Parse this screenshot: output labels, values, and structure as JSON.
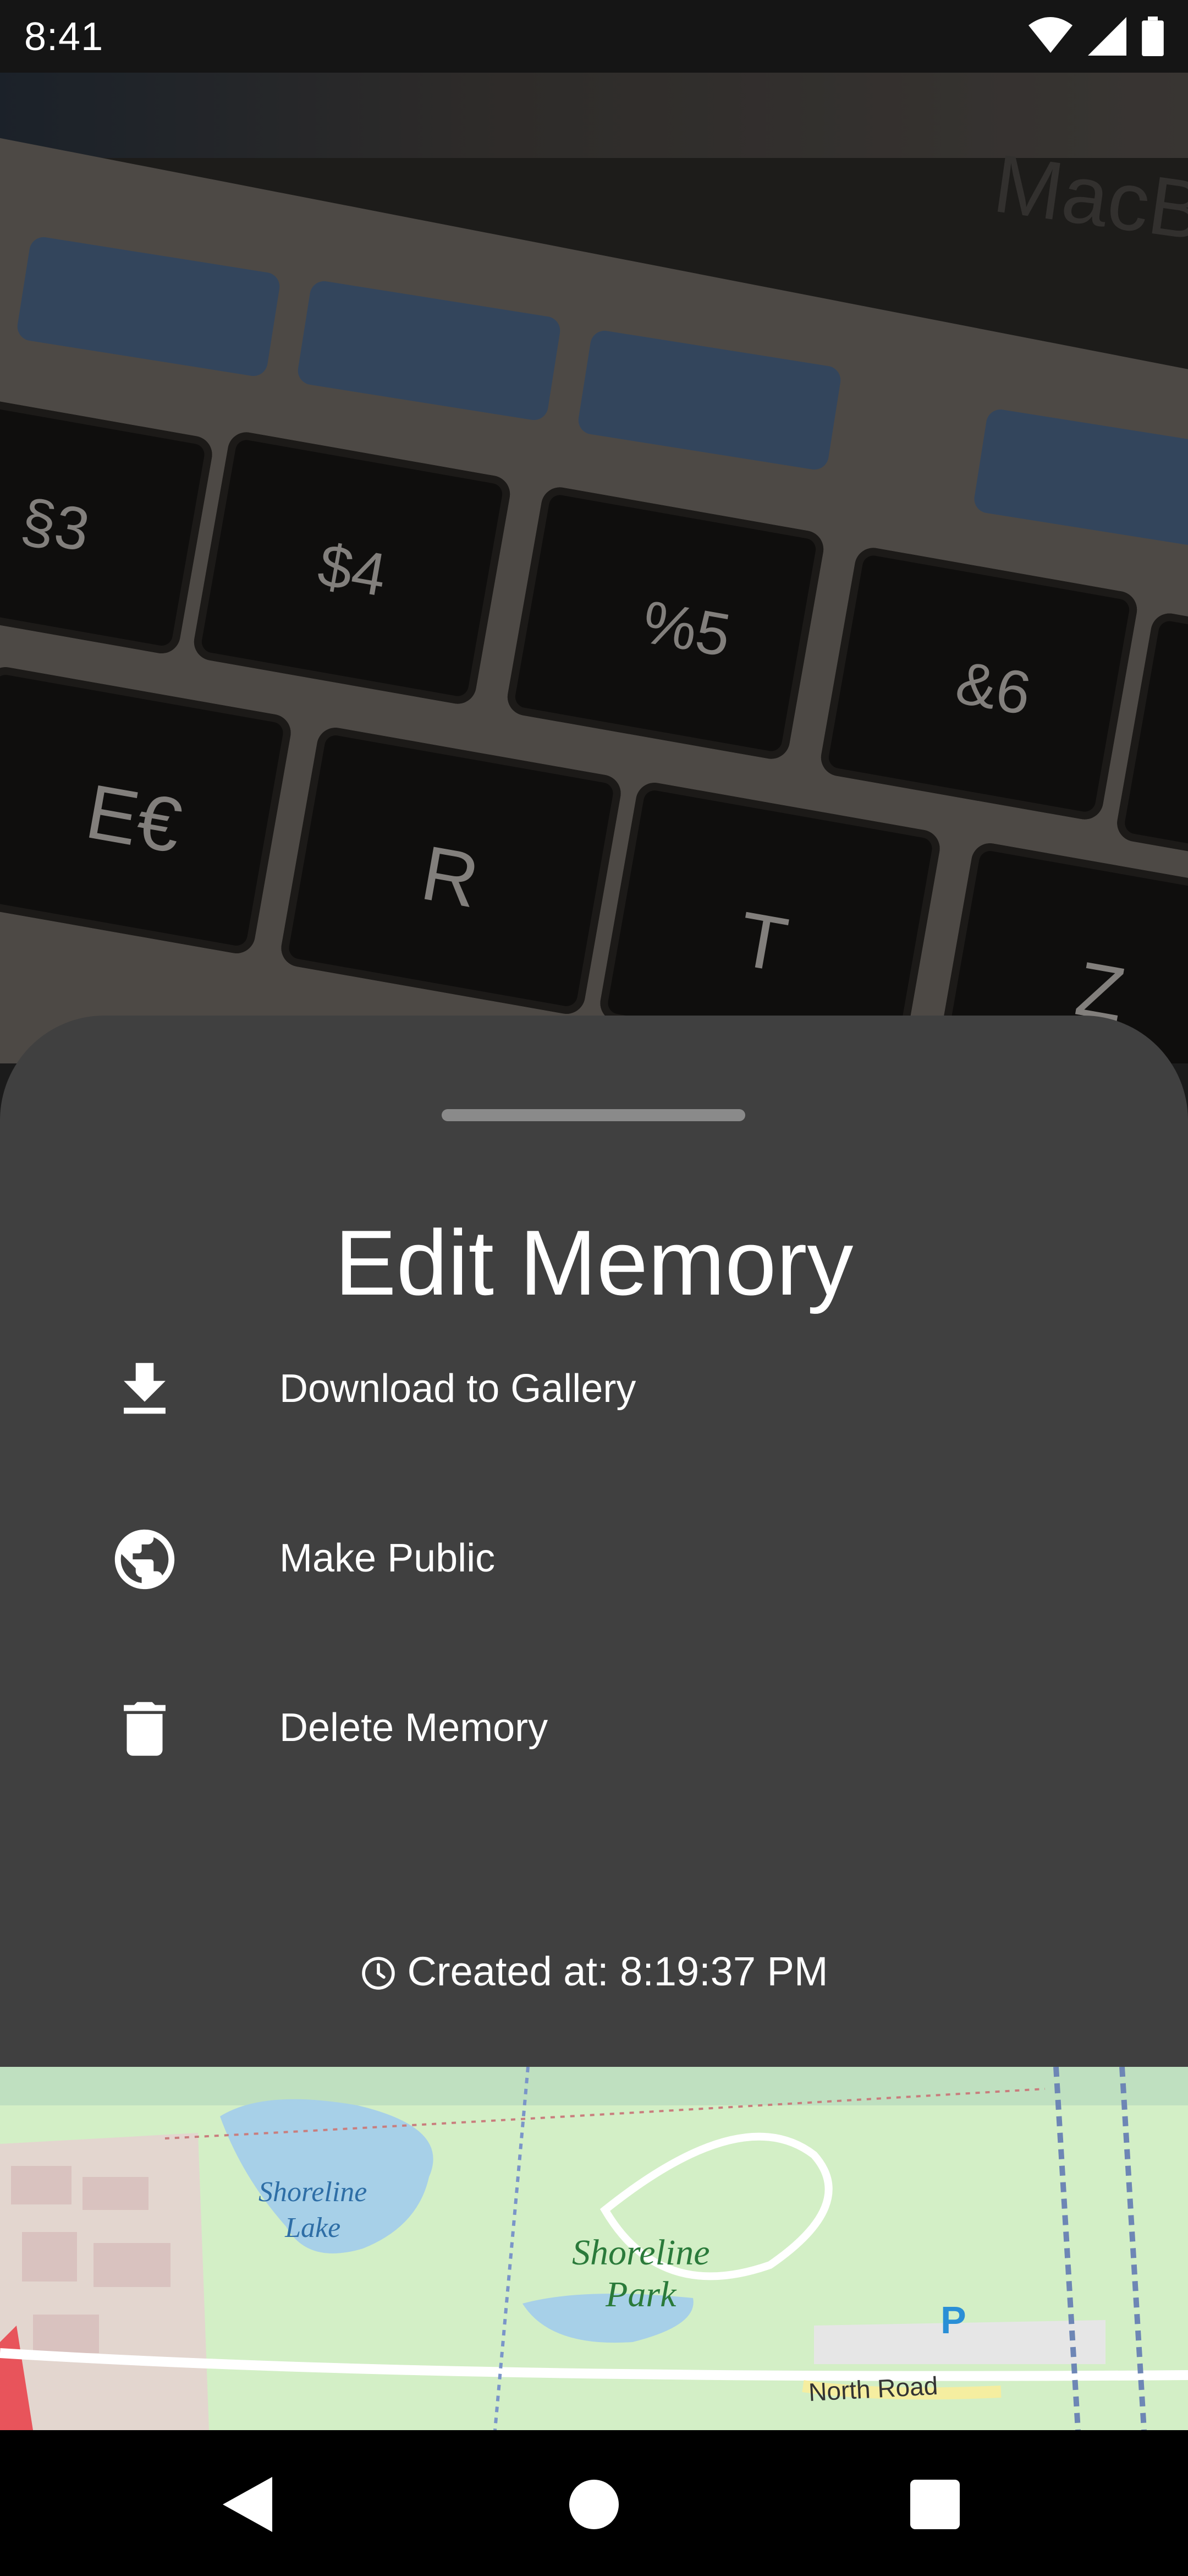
{
  "status_bar": {
    "time": "8:41",
    "icons": [
      "wifi-icon",
      "signal-icon",
      "battery-icon"
    ]
  },
  "background_photo": {
    "keys": [
      "§3",
      "$4",
      "%5",
      "&6",
      "E€",
      "R",
      "T",
      "Z"
    ],
    "brand_text": "MacB"
  },
  "sheet": {
    "title": "Edit Memory",
    "items": [
      {
        "label": "Download to Gallery",
        "icon": "download-icon"
      },
      {
        "label": "Make Public",
        "icon": "globe-icon"
      },
      {
        "label": "Delete Memory",
        "icon": "trash-icon"
      }
    ],
    "created_at": "Created at: 8:19:37 PM",
    "created_icon": "clock-icon"
  },
  "map": {
    "labels": {
      "lake": [
        "Shoreline",
        "Lake"
      ],
      "park": [
        "Shoreline",
        "Park"
      ],
      "road": "North Road",
      "parking": "P"
    }
  },
  "nav_bar": {
    "buttons": [
      "back-icon",
      "home-icon",
      "recents-icon"
    ]
  },
  "colors": {
    "sheet_bg": "#404040",
    "status_bg": "#151515",
    "nav_bg": "#000000"
  }
}
